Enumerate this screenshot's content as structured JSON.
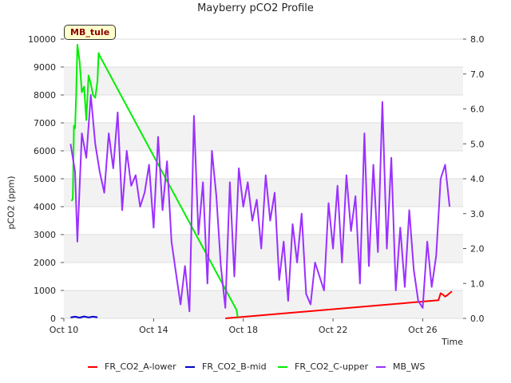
{
  "chart_data": {
    "type": "line",
    "title": "Mayberry pCO2 Profile",
    "xlabel": "Time",
    "ylabel": "pCO2 (ppm)",
    "annotation": "MB_tule",
    "x_ticks": [
      "Oct 10",
      "Oct 14",
      "Oct 18",
      "Oct 22",
      "Oct 26"
    ],
    "x_tick_days": [
      10,
      14,
      18,
      22,
      26
    ],
    "xlim": [
      10,
      27.8
    ],
    "ylim": [
      0,
      10000
    ],
    "y_ticks": [
      "0",
      "1000",
      "2000",
      "3000",
      "4000",
      "5000",
      "6000",
      "7000",
      "8000",
      "9000",
      "10000"
    ],
    "y2lim": [
      0,
      8
    ],
    "y2_ticks": [
      "0.0",
      "1.0",
      "2.0",
      "3.0",
      "4.0",
      "5.0",
      "6.0",
      "7.0",
      "8.0"
    ],
    "grid": "horizontal bands",
    "legend_position": "bottom",
    "series": [
      {
        "name": "FR_CO2_A-lower",
        "color": "#ff0000",
        "axis": "left",
        "x": [
          17.2,
          26.7,
          26.8,
          26.9,
          27.0,
          27.1,
          27.2,
          27.3
        ],
        "y": [
          0,
          650,
          900,
          850,
          780,
          830,
          900,
          970
        ]
      },
      {
        "name": "FR_CO2_B-mid",
        "color": "#0000cc",
        "axis": "left",
        "x": [
          10.3,
          10.5,
          10.7,
          10.9,
          11.1,
          11.3,
          11.5
        ],
        "y": [
          30,
          60,
          25,
          70,
          35,
          60,
          40
        ]
      },
      {
        "name": "FR_CO2_C-upper",
        "color": "#00ee00",
        "axis": "left",
        "x": [
          10.35,
          10.4,
          10.45,
          10.5,
          10.55,
          10.6,
          10.7,
          10.8,
          10.9,
          11.0,
          11.1,
          11.2,
          11.3,
          11.4,
          11.5,
          11.55,
          11.6,
          17.7,
          17.75
        ],
        "y": [
          4200,
          4300,
          6900,
          6800,
          8000,
          9800,
          9200,
          8100,
          8300,
          7100,
          8700,
          8400,
          8000,
          7900,
          8500,
          9500,
          9400,
          300,
          50
        ]
      },
      {
        "name": "MB_WS",
        "color": "#9b30ff",
        "axis": "right",
        "x": [
          10.3,
          10.5,
          10.6,
          10.8,
          11.0,
          11.2,
          11.4,
          11.6,
          11.8,
          12.0,
          12.2,
          12.4,
          12.6,
          12.8,
          13.0,
          13.2,
          13.4,
          13.6,
          13.8,
          14.0,
          14.2,
          14.4,
          14.6,
          14.8,
          15.0,
          15.2,
          15.4,
          15.6,
          15.8,
          16.0,
          16.2,
          16.4,
          16.6,
          16.8,
          17.0,
          17.2,
          17.4,
          17.6,
          17.8,
          18.0,
          18.2,
          18.4,
          18.6,
          18.8,
          19.0,
          19.2,
          19.4,
          19.6,
          19.8,
          20.0,
          20.2,
          20.4,
          20.6,
          20.8,
          21.0,
          21.2,
          21.4,
          21.6,
          21.8,
          22.0,
          22.2,
          22.4,
          22.6,
          22.8,
          23.0,
          23.2,
          23.4,
          23.6,
          23.8,
          24.0,
          24.2,
          24.4,
          24.6,
          24.8,
          25.0,
          25.2,
          25.4,
          25.6,
          25.8,
          26.0,
          26.2,
          26.4,
          26.6,
          26.8,
          27.0,
          27.2
        ],
        "y": [
          5.0,
          4.2,
          2.2,
          5.3,
          4.6,
          6.4,
          5.0,
          4.2,
          3.6,
          5.3,
          4.3,
          5.9,
          3.1,
          4.8,
          3.8,
          4.1,
          3.2,
          3.6,
          4.4,
          2.6,
          5.2,
          3.1,
          4.5,
          2.2,
          1.3,
          0.4,
          1.5,
          0.2,
          5.8,
          2.4,
          3.9,
          1.0,
          4.8,
          3.5,
          1.5,
          0.3,
          3.9,
          1.2,
          4.3,
          3.2,
          3.9,
          2.8,
          3.4,
          2.0,
          4.1,
          2.8,
          3.6,
          1.1,
          2.2,
          0.5,
          2.7,
          1.6,
          3.0,
          0.7,
          0.4,
          1.6,
          1.2,
          0.8,
          3.3,
          2.0,
          3.8,
          1.6,
          4.1,
          2.5,
          3.5,
          1.0,
          5.3,
          1.5,
          4.4,
          1.9,
          6.2,
          2.0,
          4.6,
          0.8,
          2.6,
          0.9,
          3.1,
          1.4,
          0.5,
          0.3,
          2.2,
          0.9,
          1.8,
          4.0,
          4.4,
          3.2
        ]
      }
    ]
  }
}
